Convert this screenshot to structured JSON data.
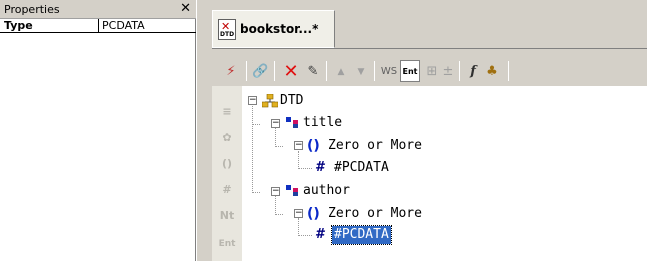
{
  "properties_panel": {
    "title": "Properties",
    "close_glyph": "✕",
    "rows": [
      {
        "key": "Type",
        "value": "PCDATA"
      }
    ]
  },
  "editor": {
    "tab": {
      "label": "bookstor...*",
      "icon_text": "DTD"
    },
    "toolbar": {
      "items": [
        {
          "name": "validate-icon",
          "glyph": "⚡"
        },
        {
          "name": "check-icon",
          "glyph": "🔗"
        },
        {
          "name": "delete-icon",
          "glyph": "✕"
        },
        {
          "name": "edit-icon",
          "glyph": "✎"
        },
        {
          "name": "move-up-icon",
          "glyph": "▲"
        },
        {
          "name": "move-down-icon",
          "glyph": "▼"
        },
        {
          "name": "ws-label",
          "glyph": "WS"
        },
        {
          "name": "ent-icon",
          "glyph": "Ent"
        },
        {
          "name": "attr-icon",
          "glyph": "⊞"
        },
        {
          "name": "plus-minus-icon",
          "glyph": "±"
        },
        {
          "name": "function-icon",
          "glyph": "f"
        },
        {
          "name": "tree-icon",
          "glyph": "♣"
        }
      ]
    },
    "gutter_icons": [
      "element-icon",
      "attribute-icon",
      "group-icon",
      "pcdata-icon",
      "notation-icon",
      "entity-icon"
    ],
    "gutter_glyphs": [
      "≡",
      "✿",
      "()",
      "#",
      "Nt",
      "Ent"
    ],
    "tree": {
      "root": "DTD",
      "nodes": [
        {
          "label": "title",
          "child": "Zero or More",
          "leaf": "#PCDATA"
        },
        {
          "label": "author",
          "child": "Zero or More",
          "leaf": "#PCDATA"
        }
      ],
      "leaf_glyph": "#",
      "group_glyph": "()"
    },
    "colors": {
      "selection": "#316ac5",
      "group": "#0a28c8"
    }
  }
}
